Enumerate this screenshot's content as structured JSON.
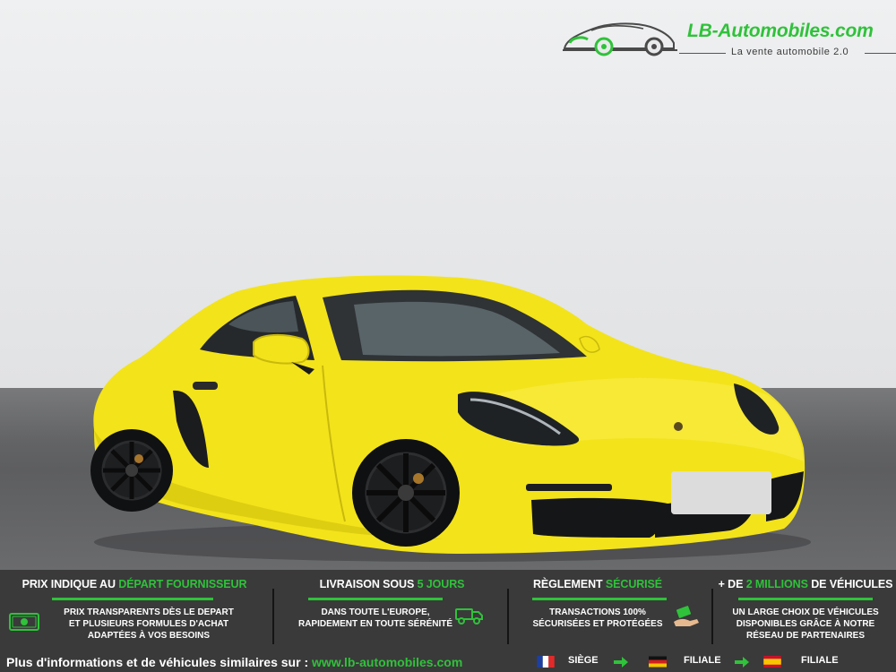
{
  "brand": {
    "name": "LB-Automobiles.com",
    "tagline": "La vente automobile 2.0",
    "accent": "#2fc23a"
  },
  "photo": {
    "subject": "yellow sports coupe",
    "car_color": "#f2e019"
  },
  "banner": {
    "background": "#3a3a3a",
    "col1": {
      "title_prefix": "PRIX INDIQUE AU ",
      "title_highlight": "DÉPART FOURNISSEUR",
      "lines": [
        "PRIX TRANSPARENTS DÈS LE DEPART",
        "ET PLUSIEURS FORMULES D'ACHAT",
        "ADAPTÉES À VOS BESOINS"
      ],
      "icon": "money-icon"
    },
    "col2": {
      "title_prefix": "LIVRAISON SOUS ",
      "title_highlight": "5 JOURS",
      "lines": [
        "DANS TOUTE L'EUROPE,",
        "RAPIDEMENT EN TOUTE SÉRÉNITÉ"
      ],
      "icon": "delivery-truck-icon"
    },
    "col3": {
      "title_prefix": "RÈGLEMENT ",
      "title_highlight": "SÉCURISÉ",
      "lines": [
        "TRANSACTIONS 100%",
        "SÉCURISÉES ET PROTÉGÉES"
      ],
      "icon": "secure-payment-icon"
    },
    "col4": {
      "title_prefix": "+ DE ",
      "title_highlight": "2 MILLIONS",
      "title_suffix": " DE VÉHICULES",
      "lines": [
        "UN LARGE CHOIX DE VÉHICULES",
        "DISPONIBLES GRÂCE À NOTRE",
        "RÉSEAU DE PARTENAIRES"
      ]
    },
    "footer": {
      "text": "Plus d'informations et de véhicules similaires sur : ",
      "url": "www.lb-automobiles.com"
    },
    "locations": [
      {
        "flag": "france-flag-icon",
        "label": "SIÈGE"
      },
      {
        "flag": "germany-flag-icon",
        "label": "FILIALE"
      },
      {
        "flag": "spain-flag-icon",
        "label": "FILIALE"
      }
    ]
  }
}
